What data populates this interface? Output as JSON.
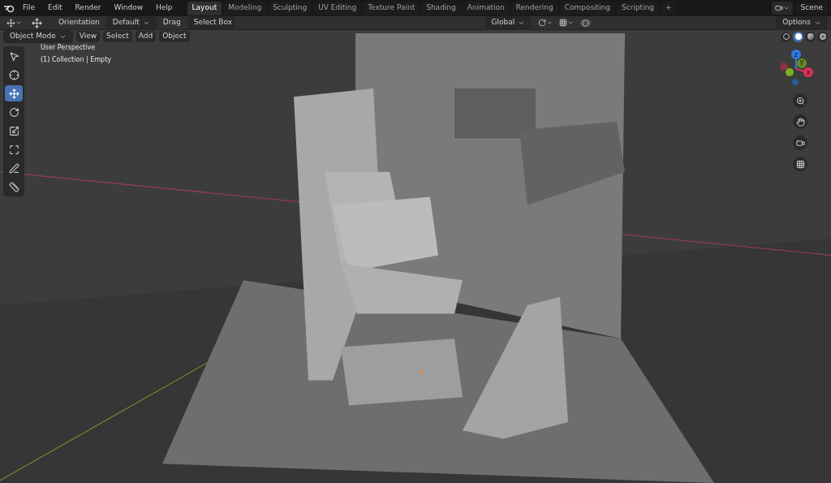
{
  "menus": [
    "File",
    "Edit",
    "Render",
    "Window",
    "Help"
  ],
  "workspaces": [
    {
      "label": "Layout",
      "selected": true
    },
    {
      "label": "Modeling",
      "selected": false
    },
    {
      "label": "Sculpting",
      "selected": false
    },
    {
      "label": "UV Editing",
      "selected": false
    },
    {
      "label": "Texture Paint",
      "selected": false
    },
    {
      "label": "Shading",
      "selected": false
    },
    {
      "label": "Animation",
      "selected": false
    },
    {
      "label": "Rendering",
      "selected": false
    },
    {
      "label": "Compositing",
      "selected": false
    },
    {
      "label": "Scripting",
      "selected": false
    }
  ],
  "add_workspace": "+",
  "scene": "Scene",
  "tool_header": {
    "orientation_label": "Orientation",
    "orientation": "Default",
    "drag_label": "Drag",
    "drag": "Select Box",
    "transform": "Global",
    "options": "Options"
  },
  "viewport_menus": {
    "mode": "Object Mode",
    "items": [
      "View",
      "Select",
      "Add",
      "Object"
    ]
  },
  "shading_modes": [
    {
      "kind": "wireframe",
      "selected": false
    },
    {
      "kind": "solid",
      "selected": true
    },
    {
      "kind": "material",
      "selected": false
    },
    {
      "kind": "rendered",
      "selected": false
    }
  ],
  "viewport": {
    "view_name": "User Perspective",
    "collection": "(1) Collection | Empty"
  },
  "tools": [
    {
      "kind": "select",
      "selected": false
    },
    {
      "kind": "cursor",
      "selected": false
    },
    {
      "kind": "move",
      "selected": true
    },
    {
      "kind": "rotate",
      "selected": false
    },
    {
      "kind": "scale",
      "selected": false
    },
    {
      "kind": "transform",
      "selected": false
    },
    {
      "kind": "annotate",
      "selected": false
    },
    {
      "kind": "measure",
      "selected": false
    }
  ],
  "gizmo": {
    "z": "Z",
    "y": "Y",
    "x": "X"
  }
}
